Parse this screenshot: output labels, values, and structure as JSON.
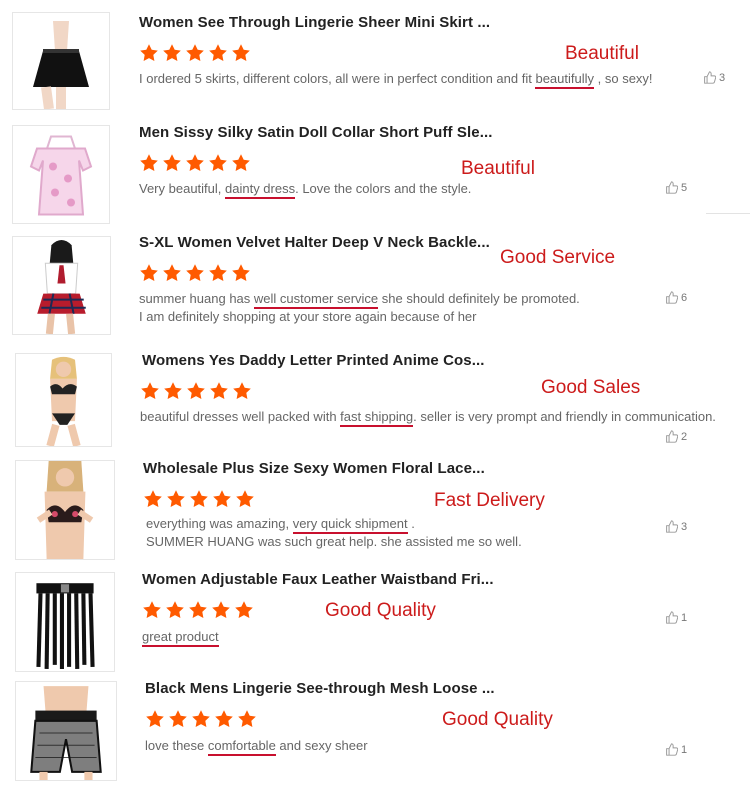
{
  "reviews": [
    {
      "title": "Women See Through Lingerie Sheer Mini Skirt ...",
      "rating": 5,
      "tag": "Beautiful",
      "lines": [
        [
          "I ordered 5 skirts, different colors, all were in perfect condition and fit ",
          "beautifully",
          " , so sexy!"
        ]
      ],
      "likes": "3",
      "thumb_icon": "black-mini-skirt"
    },
    {
      "title": "Men Sissy Silky Satin Doll Collar Short Puff Sle...",
      "rating": 5,
      "tag": "Beautiful",
      "lines": [
        [
          "Very beautiful, ",
          "dainty dress",
          ". Love the colors and the style."
        ]
      ],
      "likes": "5",
      "thumb_icon": "pink-satin-dress"
    },
    {
      "title": "S-XL Women Velvet Halter Deep V Neck Backle...",
      "rating": 5,
      "tag": "Good Service",
      "lines": [
        [
          "summer huang has ",
          "well customer service",
          " she should definitely be promoted."
        ],
        [
          " I am definitely shopping at your store again because of her",
          "",
          ""
        ]
      ],
      "likes": "6",
      "thumb_icon": "schoolgirl-costume"
    },
    {
      "title": "Womens Yes Daddy Letter Printed Anime Cos...",
      "rating": 5,
      "tag": "Good Sales",
      "lines": [
        [
          "beautiful dresses well packed with ",
          "fast shipping",
          ". seller is very prompt and friendly in communication."
        ]
      ],
      "likes": "2",
      "thumb_icon": "anime-bikini-set"
    },
    {
      "title": "Wholesale Plus Size Sexy Women Floral Lace...",
      "rating": 5,
      "tag": "Fast Delivery",
      "lines": [
        [
          "everything was amazing, ",
          "very quick shipment",
          " ."
        ],
        [
          "SUMMER HUANG was such great help. she assisted me so well.",
          "",
          ""
        ]
      ],
      "likes": "3",
      "thumb_icon": "floral-lace-bra"
    },
    {
      "title": "Women Adjustable Faux Leather Waistband Fri...",
      "rating": 5,
      "tag": "Good Quality",
      "lines": [
        [
          "",
          "great product",
          ""
        ]
      ],
      "likes": "1",
      "thumb_icon": "fringe-leather-skirt"
    },
    {
      "title": "Black Mens Lingerie See-through Mesh Loose ...",
      "rating": 5,
      "tag": "Good Quality",
      "lines": [
        [
          "love these ",
          "comfortable",
          " and sexy sheer"
        ]
      ],
      "likes": "1",
      "thumb_icon": "mesh-shorts"
    }
  ],
  "colors": {
    "star": "#ff5a00",
    "tag": "#cc1b1b",
    "underline": "#c8102e"
  }
}
